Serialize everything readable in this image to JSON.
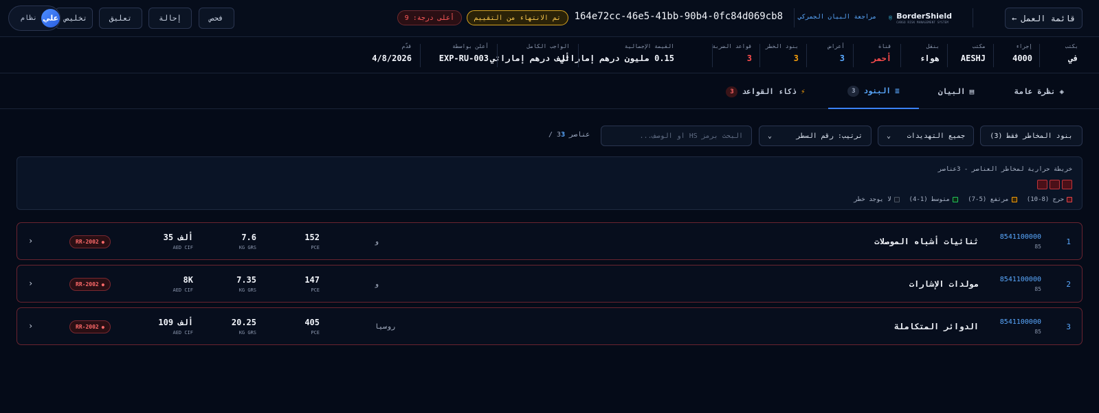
{
  "header": {
    "menu_label": "قائمة العمل",
    "menu_arrow": "←",
    "logo_name": "BorderShield",
    "logo_sub": "CARGO RISK MANAGEMENT SYSTEM",
    "review_label": "مراجعة البيان الجمركي",
    "declaration_id": "164e72cc-46e5-41bb-90b4-0fc84d069cb8",
    "status_badge": "تم الانتهاء من التقييم",
    "score_badge": "أعلى درجة: 9",
    "actions": [
      "فحص",
      "إحالة",
      "تعليق",
      "تخليص"
    ],
    "user_name": "نظام",
    "user_avatar": "علي"
  },
  "meta": [
    {
      "label": "بكتب",
      "value": "في",
      "color": "#f2f5fb"
    },
    {
      "label": "إجراء",
      "value": "4000",
      "color": "#f2f5fb"
    },
    {
      "label": "مكتب",
      "value": "AESHJ",
      "color": "#f2f5fb"
    },
    {
      "label": "بنقل",
      "value": "هواء",
      "color": "#f2f5fb"
    },
    {
      "label": "قناة",
      "value": "أحمر",
      "color": "#ff4d4d"
    },
    {
      "label": "أعراض",
      "value": "3",
      "color": "#5aa9ff"
    },
    {
      "label": "بنود الخطر",
      "value": "3",
      "color": "#f59e0b"
    },
    {
      "label": "قواعد الضربة",
      "value": "3",
      "color": "#ff4d4d"
    },
    {
      "label": "القيمة الإجمالية",
      "value": "0.15 مليون درهم إماراتي",
      "color": "#f2f5fb"
    },
    {
      "label": "الواجب الكامل",
      "value": "ألف درهم إماراتي",
      "color": "#f2f5fb"
    },
    {
      "label": "أعلن بواسطة",
      "value": "EXP-RU-003",
      "color": "#f2f5fb"
    },
    {
      "label": "قدّم",
      "value": "4/8/2026",
      "color": "#f2f5fb"
    }
  ],
  "tabs": [
    {
      "label": "نظرة عامة",
      "icon": "◈",
      "count": ""
    },
    {
      "label": "البيان",
      "icon": "▤",
      "count": ""
    },
    {
      "label": "البنود",
      "icon": "≡",
      "count": "3"
    },
    {
      "label": "ذكاء القواعد",
      "icon": "⚡",
      "count": "3"
    }
  ],
  "toolbar": {
    "risk_only": "بنود المخاطر فقط (3)",
    "threats": "جميع التهديدات",
    "sort": "ترتيب: رقم السطر",
    "search_placeholder": "البحث برمز HS أو الوصف...",
    "count_shown": "3",
    "count_rest": "/ 3عناصر"
  },
  "heatmap": {
    "title": "خريطة حرارية لمخاطر العناصر - 3عناصر",
    "legend": [
      {
        "label": "حرج (8-10)",
        "color": "#e0474c"
      },
      {
        "label": "مرتفع (5-7)",
        "color": "#f59e0b"
      },
      {
        "label": "متوسط (1-4)",
        "color": "#22c55e"
      },
      {
        "label": "لا يوجد خطر",
        "color": "#4b5563"
      }
    ]
  },
  "items": [
    {
      "index": "1",
      "hs": "8541100000",
      "chapter": "85",
      "desc": "ثنائيات أشباه الموصلات",
      "origin": "و",
      "qty": "152",
      "qty_unit": "PCE",
      "weight": "7.6",
      "weight_unit": "KG GRS",
      "value": "35 ألف",
      "value_unit": "AED CIF",
      "rule": "RR-2002"
    },
    {
      "index": "2",
      "hs": "8541100000",
      "chapter": "85",
      "desc": "مولدات الإشارات",
      "origin": "و",
      "qty": "147",
      "qty_unit": "PCE",
      "weight": "7.35",
      "weight_unit": "KG GRS",
      "value": "8K",
      "value_unit": "AED CIF",
      "rule": "RR-2002"
    },
    {
      "index": "3",
      "hs": "8541100000",
      "chapter": "85",
      "desc": "الدوائر المتكاملة",
      "origin": "روسيا",
      "qty": "405",
      "qty_unit": "PCE",
      "weight": "20.25",
      "weight_unit": "KG GRS",
      "value": "109 ألف",
      "value_unit": "AED CIF",
      "rule": "RR-2002"
    }
  ]
}
